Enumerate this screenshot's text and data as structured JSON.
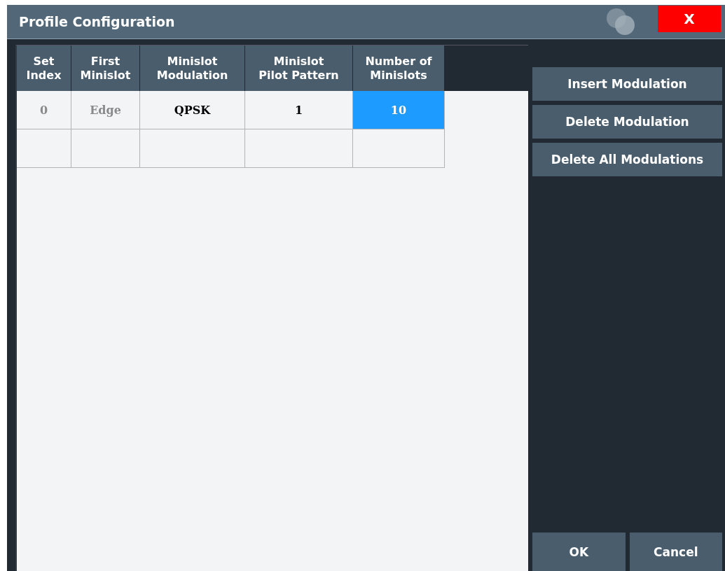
{
  "window": {
    "title": "Profile Configuration",
    "close_label": "X"
  },
  "table": {
    "columns": [
      "Set\nIndex",
      "First\nMinislot",
      "Minislot\nModulation",
      "Minislot\nPilot Pattern",
      "Number of\nMinislots"
    ],
    "rows": [
      [
        {
          "text": "0",
          "disabled": true,
          "selected": false
        },
        {
          "text": "Edge",
          "disabled": true,
          "selected": false
        },
        {
          "text": "QPSK",
          "disabled": false,
          "selected": false
        },
        {
          "text": "1",
          "disabled": false,
          "selected": false
        },
        {
          "text": "10",
          "disabled": false,
          "selected": true
        }
      ],
      [
        {
          "selected": false
        },
        {
          "selected": false
        },
        {
          "selected": false
        },
        {
          "selected": false
        },
        {
          "selected": false
        }
      ]
    ]
  },
  "side_buttons": [
    "Insert Modulation",
    "Delete Modulation",
    "Delete All Modulations"
  ],
  "buttons": [
    "OK",
    "Cancel"
  ]
}
